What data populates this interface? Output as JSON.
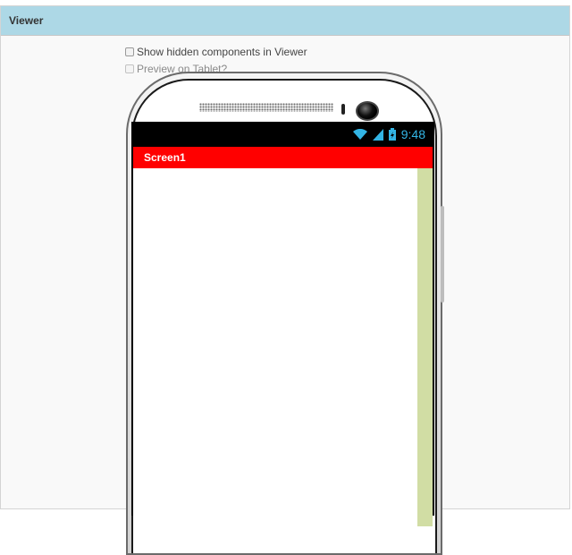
{
  "panel": {
    "title": "Viewer"
  },
  "options": {
    "show_hidden": {
      "label": "Show hidden components in Viewer",
      "checked": false
    },
    "preview_tablet": {
      "label": "Preview on Tablet?",
      "checked": false,
      "disabled": true
    }
  },
  "phone": {
    "status_time": "9:48",
    "status_icons": [
      "wifi-icon",
      "signal-icon",
      "battery-icon"
    ],
    "screen_title": "Screen1",
    "title_bar_color": "#ff0000",
    "status_text_color": "#33b5e5",
    "scroll_strip_color": "#d1dda4"
  }
}
